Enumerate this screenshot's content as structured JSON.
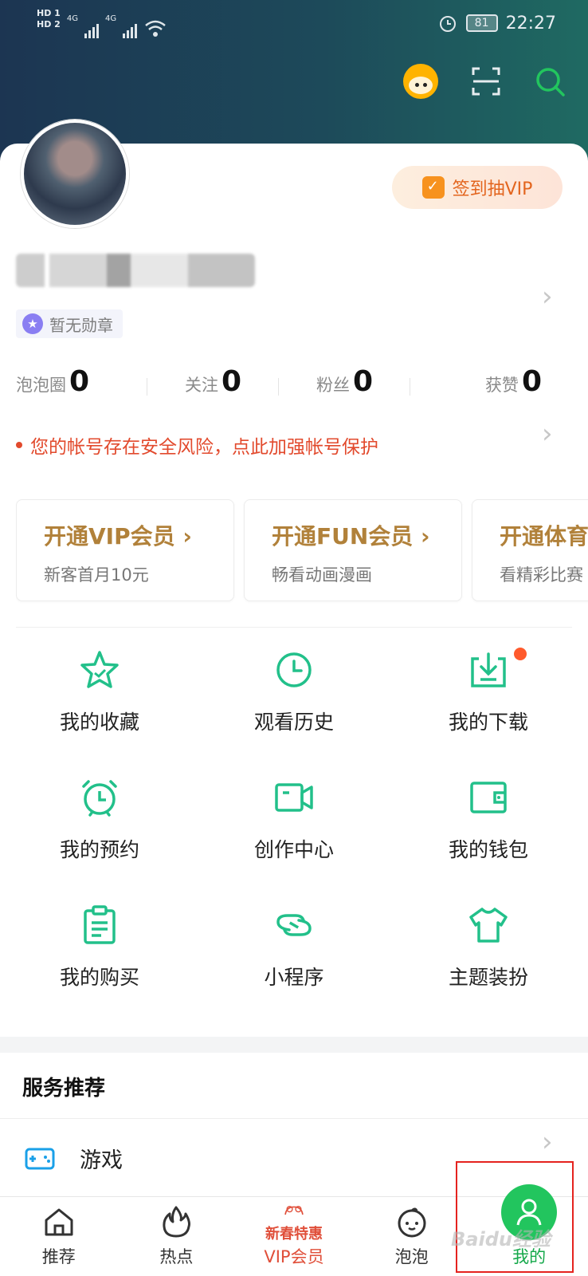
{
  "status_bar": {
    "hd_top": "HD 1",
    "hd_bottom": "HD 2",
    "net1": "4G",
    "net2": "4G",
    "battery": "81",
    "time": "22:27"
  },
  "header_icons": [
    "mascot-icon",
    "scan-icon",
    "search-icon"
  ],
  "profile": {
    "signin_label": "签到抽VIP",
    "badge_label": "暂无勋章",
    "stats": [
      {
        "label": "泡泡圈",
        "value": "0"
      },
      {
        "label": "关注",
        "value": "0"
      },
      {
        "label": "粉丝",
        "value": "0"
      },
      {
        "label": "获赞",
        "value": "0"
      }
    ],
    "security_alert": "您的帐号存在安全风险，点此加强帐号保护"
  },
  "vip_cards": [
    {
      "title": "开通VIP会员 ›",
      "sub": "新客首月10元"
    },
    {
      "title": "开通FUN会员 ›",
      "sub": "畅看动画漫画"
    },
    {
      "title": "开通体育",
      "sub": "看精彩比赛"
    }
  ],
  "grid": [
    {
      "label": "我的收藏",
      "icon": "star-icon"
    },
    {
      "label": "观看历史",
      "icon": "clock-icon"
    },
    {
      "label": "我的下载",
      "icon": "download-icon"
    },
    {
      "label": "我的预约",
      "icon": "alarm-icon"
    },
    {
      "label": "创作中心",
      "icon": "video-camera-icon"
    },
    {
      "label": "我的钱包",
      "icon": "wallet-icon"
    },
    {
      "label": "我的购买",
      "icon": "clipboard-icon"
    },
    {
      "label": "小程序",
      "icon": "link-icon"
    },
    {
      "label": "主题装扮",
      "icon": "tshirt-icon"
    }
  ],
  "services": {
    "title": "服务推荐",
    "items": [
      {
        "label": "游戏",
        "icon": "gamepad-icon"
      }
    ]
  },
  "bottom_nav": {
    "home": "推荐",
    "hot": "热点",
    "vip_promo": "新春特惠",
    "vip": "VIP会员",
    "bubble": "泡泡",
    "mine": "我的"
  },
  "watermark": "Baidu经验",
  "colors": {
    "accent_green": "#22c55e",
    "alert_red": "#e24a2d",
    "vip_gold": "#b1813a",
    "signin_orange": "#e3651e"
  }
}
